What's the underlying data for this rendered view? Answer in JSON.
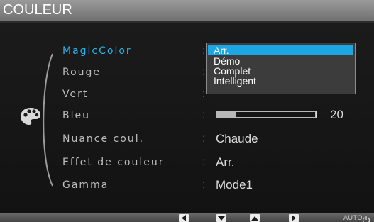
{
  "title": "COULEUR",
  "menu_icon": "color-palette-icon",
  "items": [
    {
      "label": "MagicColor",
      "value": "",
      "selected": true
    },
    {
      "label": "Rouge",
      "value": ""
    },
    {
      "label": "Vert",
      "value": ""
    },
    {
      "label": "Bleu",
      "value": "20",
      "level": 0.2
    },
    {
      "label": "Nuance coul.",
      "value": "Chaude"
    },
    {
      "label": "Effet de couleur",
      "value": "Arr."
    },
    {
      "label": "Gamma",
      "value": "Mode1"
    }
  ],
  "dropdown": {
    "options": [
      "Arr.",
      "Démo",
      "Complet",
      "Intelligent"
    ],
    "selected": "Arr."
  },
  "bottom_bar": {
    "keys": [
      "left-arrow-key-icon",
      "down-arrow-key-icon",
      "up-arrow-key-icon",
      "enter-key-icon"
    ],
    "auto_label": "AUTO",
    "power_icon": "power-icon"
  },
  "colors": {
    "accent": "#27b4ee",
    "highlight": "#1ca6e2",
    "title_bar": "#8a8a8a",
    "background": "#161616"
  }
}
